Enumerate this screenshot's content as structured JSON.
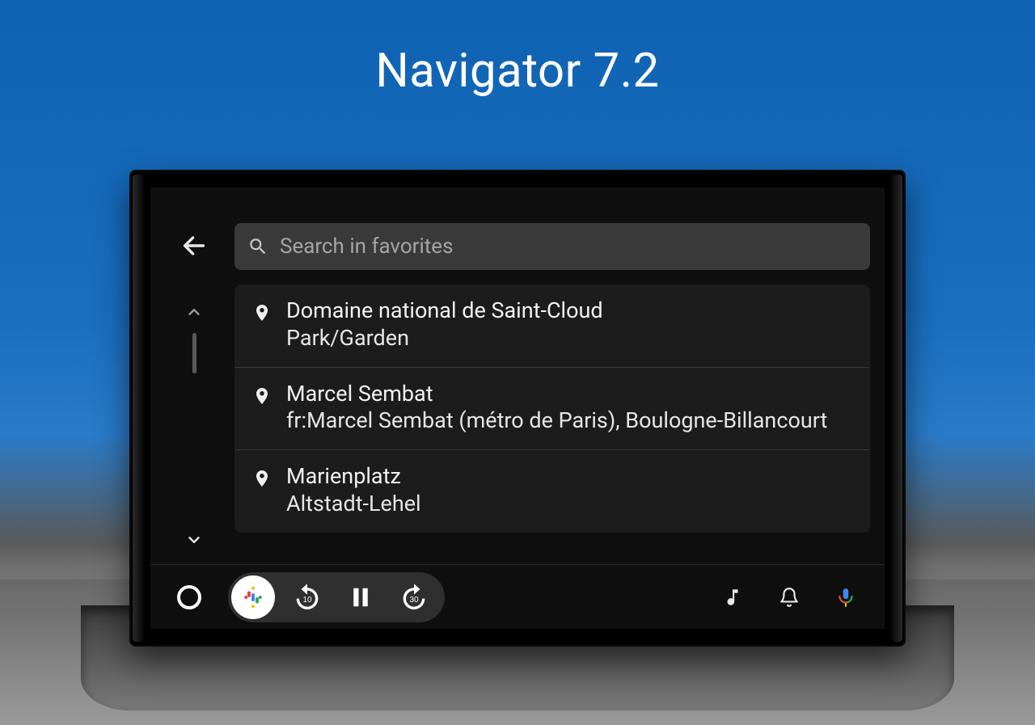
{
  "title": "Navigator 7.2",
  "search": {
    "placeholder": "Search in favorites"
  },
  "list": {
    "items": [
      {
        "title": "Domaine national de Saint-Cloud",
        "subtitle": "Park/Garden"
      },
      {
        "title": "Marcel Sembat",
        "subtitle": "fr:Marcel Sembat (métro de Paris), Boulogne-Billancourt"
      },
      {
        "title": "Marienplatz",
        "subtitle": "Altstadt-Lehel"
      }
    ]
  },
  "icons": {
    "back": "back-arrow",
    "search": "magnifier",
    "pin": "map-pin",
    "scroll_up": "chevron-up",
    "scroll_down": "chevron-down",
    "home": "circle-outline",
    "app": "google-podcasts",
    "rewind": "replay-10",
    "pause": "pause",
    "forward": "forward-30",
    "music": "music-note",
    "bell": "bell",
    "mic": "microphone"
  },
  "media": {
    "rewind_seconds": "10",
    "forward_seconds": "30"
  },
  "colors": {
    "mic_blue": "#4285F4",
    "mic_green": "#34A853",
    "mic_yellow": "#FBBC05",
    "mic_red": "#EA4335"
  }
}
